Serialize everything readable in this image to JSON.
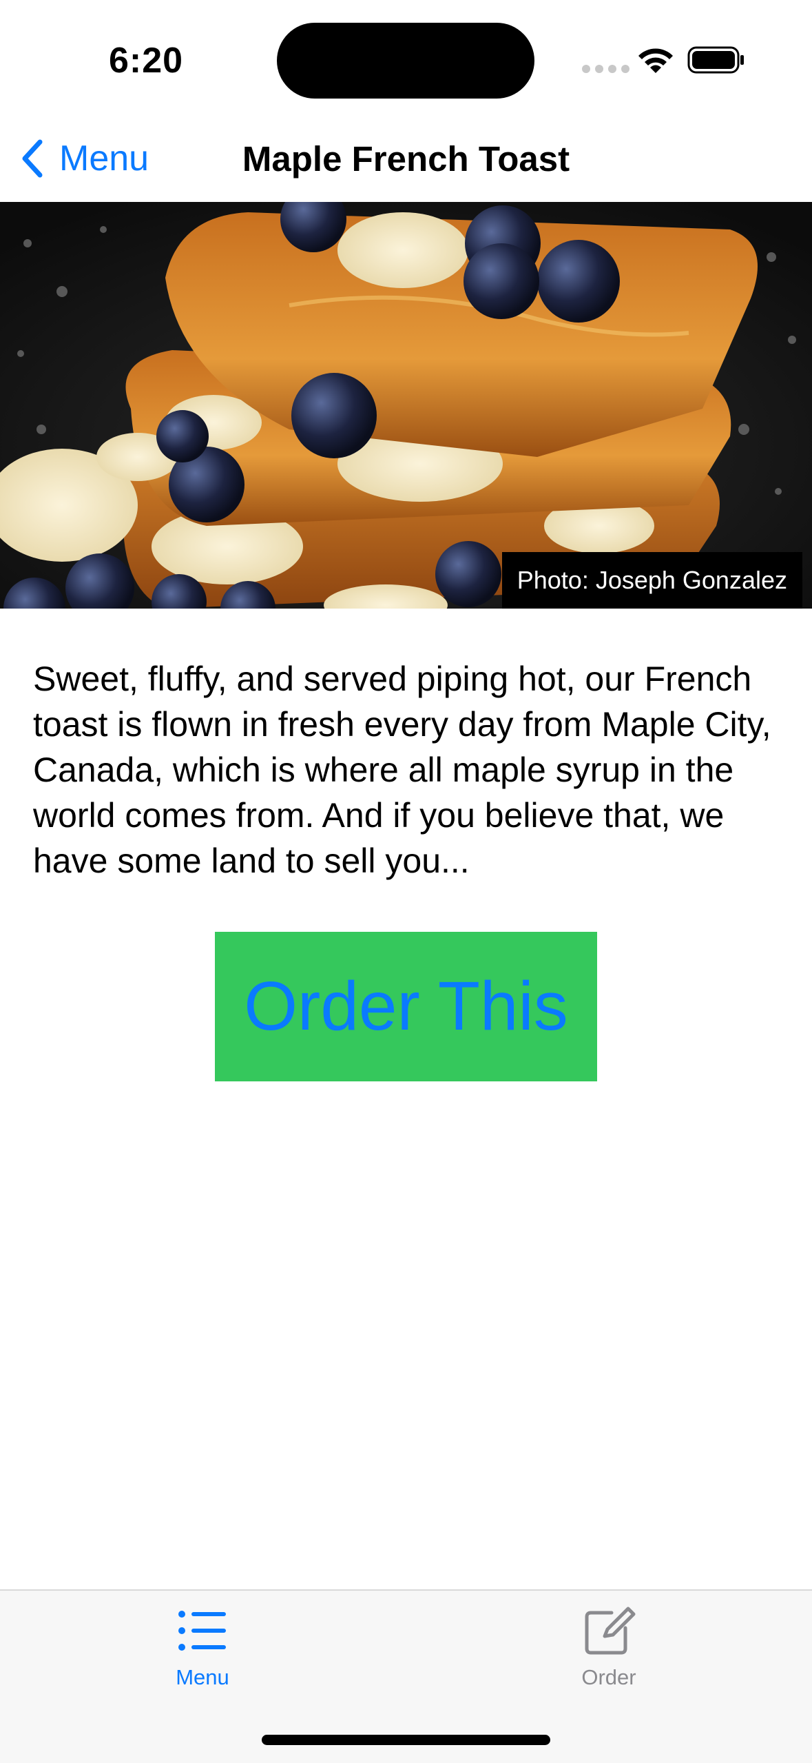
{
  "status_bar": {
    "time": "6:20"
  },
  "nav": {
    "back_label": "Menu",
    "title": "Maple French Toast"
  },
  "hero": {
    "photo_credit": "Photo: Joseph Gonzalez"
  },
  "description": "Sweet, fluffy, and served piping hot, our French toast is flown in fresh every day from Maple City, Canada, which is where all maple syrup in the world comes from. And if you believe that, we have some land to sell you...",
  "order_button": {
    "label": "Order This"
  },
  "tabbar": {
    "tabs": [
      {
        "label": "Menu",
        "icon": "list-icon",
        "selected": true
      },
      {
        "label": "Order",
        "icon": "compose-icon",
        "selected": false
      }
    ]
  },
  "colors": {
    "accent": "#0a7aff",
    "button_bg": "#35c85c",
    "tab_inactive": "#8a8a8e"
  }
}
